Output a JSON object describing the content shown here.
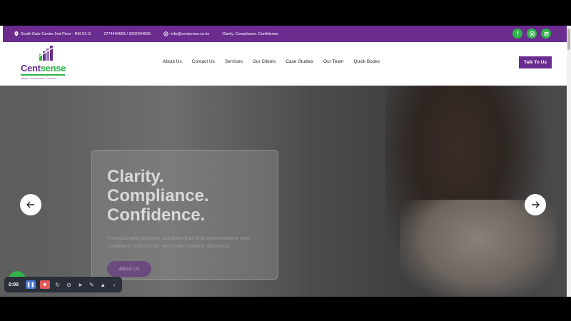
{
  "topbar": {
    "address": "South Gate Centre 2nd Floor - RM S1-G",
    "phones": "0774404555 / 0202404555",
    "email": "info@centsense.co.ke",
    "tagline": "Clarity. Compliance. Confidence.",
    "social_icons": [
      "facebook-icon",
      "instagram-icon",
      "linkedin-icon"
    ]
  },
  "logo": {
    "name_part1": "Cent",
    "name_part2": "sense",
    "tagline": "Integrity · Professionalism · Innovation"
  },
  "nav": {
    "items": [
      "About Us",
      "Contact Us",
      "Services",
      "Our Clients",
      "Case Studies",
      "Our Team",
      "Quick Books"
    ],
    "cta": "Talk To Us"
  },
  "hero": {
    "headline_1": "Clarity.",
    "headline_2": "Compliance.",
    "headline_3": "Confidence.",
    "subtext": "Financial and advisory solutions that help organizations stay compliant, reduce risk, and make smarter decisions.",
    "button": "About Us",
    "prev_icon": "arrow-left-icon",
    "next_icon": "arrow-right-icon"
  },
  "recorder": {
    "time": "0:00"
  },
  "colors": {
    "brand_purple": "#6a2c8e",
    "brand_green": "#2fb34a"
  }
}
